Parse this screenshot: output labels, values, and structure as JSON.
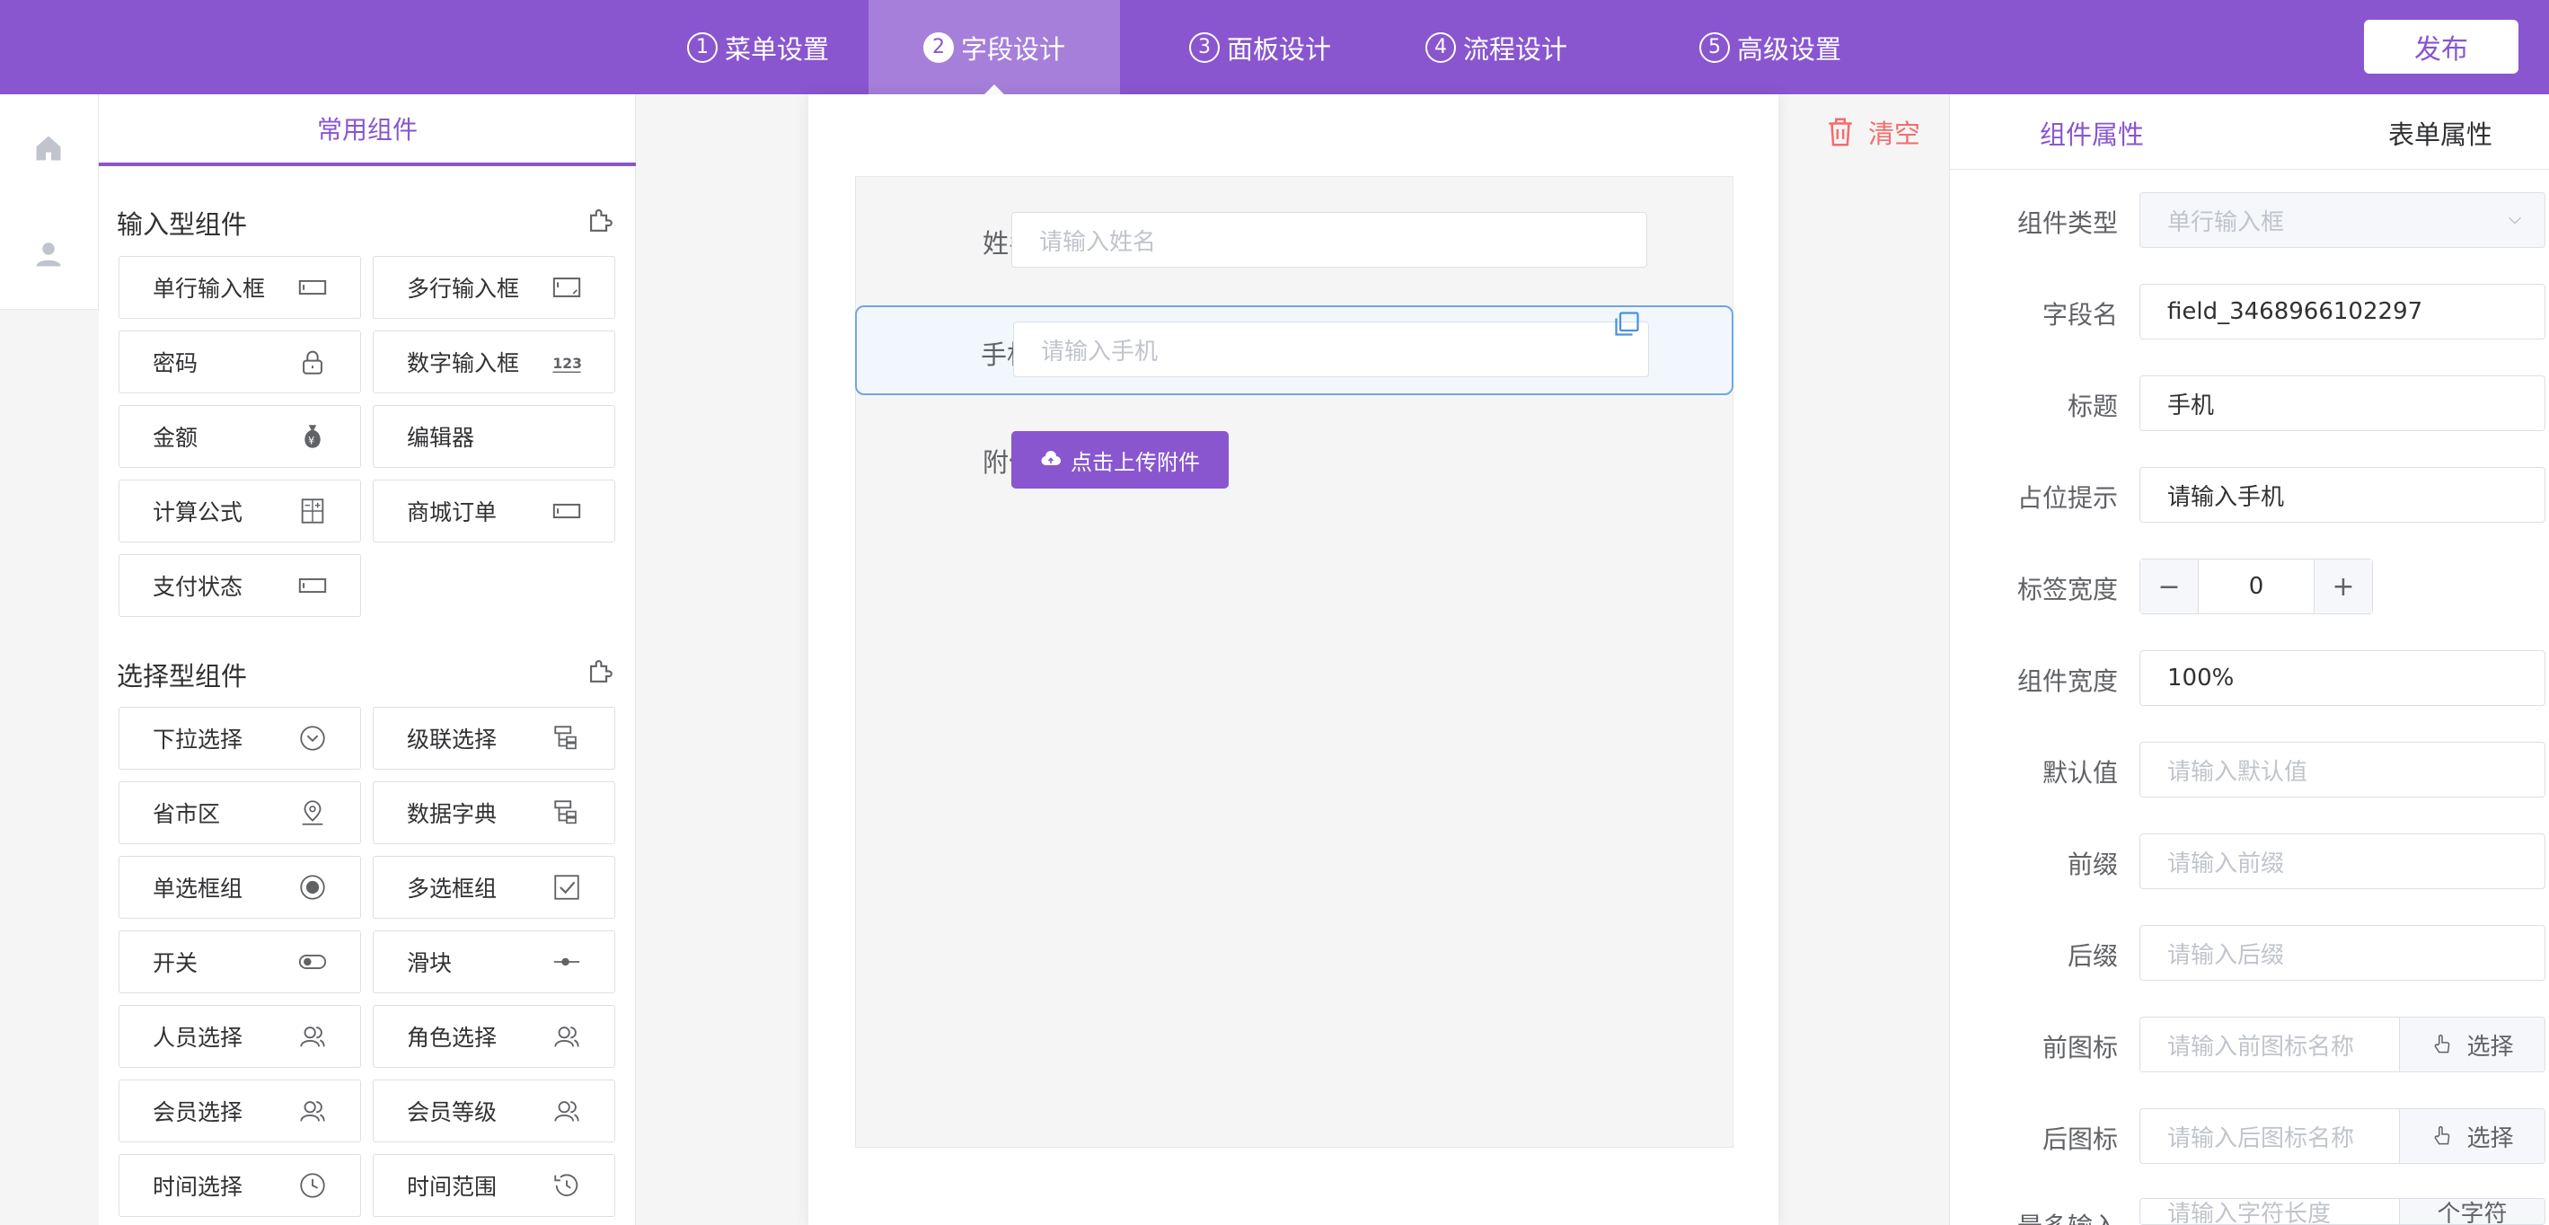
{
  "nav": {
    "steps": [
      {
        "num": "1",
        "label": "菜单设置"
      },
      {
        "num": "2",
        "label": "字段设计"
      },
      {
        "num": "3",
        "label": "面板设计"
      },
      {
        "num": "4",
        "label": "流程设计"
      },
      {
        "num": "5",
        "label": "高级设置"
      }
    ],
    "active_step": "2",
    "publish_label": "发布"
  },
  "palette": {
    "tab_label": "常用组件",
    "groups": [
      {
        "title": "输入型组件",
        "items": [
          {
            "label": "单行输入框",
            "icon": "single-line-input-icon"
          },
          {
            "label": "多行输入框",
            "icon": "textarea-icon"
          },
          {
            "label": "密码",
            "icon": "lock-icon"
          },
          {
            "label": "数字输入框",
            "icon": "number-123-icon"
          },
          {
            "label": "金额",
            "icon": "money-bag-icon"
          },
          {
            "label": "编辑器",
            "icon": ""
          },
          {
            "label": "计算公式",
            "icon": "calculator-icon"
          },
          {
            "label": "商城订单",
            "icon": "single-line-input-icon"
          },
          {
            "label": "支付状态",
            "icon": "single-line-input-icon"
          }
        ]
      },
      {
        "title": "选择型组件",
        "items": [
          {
            "label": "下拉选择",
            "icon": "chevron-circle-icon"
          },
          {
            "label": "级联选择",
            "icon": "cascade-icon"
          },
          {
            "label": "省市区",
            "icon": "location-pin-icon"
          },
          {
            "label": "数据字典",
            "icon": "cascade-icon"
          },
          {
            "label": "单选框组",
            "icon": "radio-icon"
          },
          {
            "label": "多选框组",
            "icon": "checkbox-icon"
          },
          {
            "label": "开关",
            "icon": "toggle-icon"
          },
          {
            "label": "滑块",
            "icon": "slider-icon"
          },
          {
            "label": "人员选择",
            "icon": "users-icon"
          },
          {
            "label": "角色选择",
            "icon": "users-icon"
          },
          {
            "label": "会员选择",
            "icon": "users-icon"
          },
          {
            "label": "会员等级",
            "icon": "users-icon"
          },
          {
            "label": "时间选择",
            "icon": "clock-icon"
          },
          {
            "label": "时间范围",
            "icon": "history-icon"
          }
        ]
      }
    ]
  },
  "canvas": {
    "clear_label": "清空",
    "fields": [
      {
        "label": "姓名",
        "placeholder": "请输入姓名"
      },
      {
        "label": "手机",
        "placeholder": "请输入手机"
      },
      {
        "label": "附件",
        "button": "点击上传附件"
      }
    ]
  },
  "props": {
    "tabs": [
      "组件属性",
      "表单属性"
    ],
    "active_tab": "组件属性",
    "rows": [
      {
        "label": "组件类型",
        "value": "单行输入框"
      },
      {
        "label": "字段名",
        "value": "field_3468966102297"
      },
      {
        "label": "标题",
        "value": "手机"
      },
      {
        "label": "占位提示",
        "value": "请输入手机"
      },
      {
        "label": "标签宽度",
        "value": "0"
      },
      {
        "label": "组件宽度",
        "value": "100%"
      },
      {
        "label": "默认值",
        "placeholder": "请输入默认值"
      },
      {
        "label": "前缀",
        "placeholder": "请输入前缀"
      },
      {
        "label": "后缀",
        "placeholder": "请输入后缀"
      },
      {
        "label": "前图标",
        "placeholder": "请输入前图标名称",
        "button": "选择"
      },
      {
        "label": "后图标",
        "placeholder": "请输入后图标名称",
        "button": "选择"
      },
      {
        "label": "最多输入",
        "placeholder": "请输入字符长度",
        "button": "个字符"
      }
    ],
    "stepper_minus": "−",
    "stepper_plus": "+"
  },
  "colors": {
    "brand": "#8956cf",
    "brand_active": "#a57fd9",
    "danger": "#f56c6c",
    "selected_border": "#6fa6e8"
  }
}
